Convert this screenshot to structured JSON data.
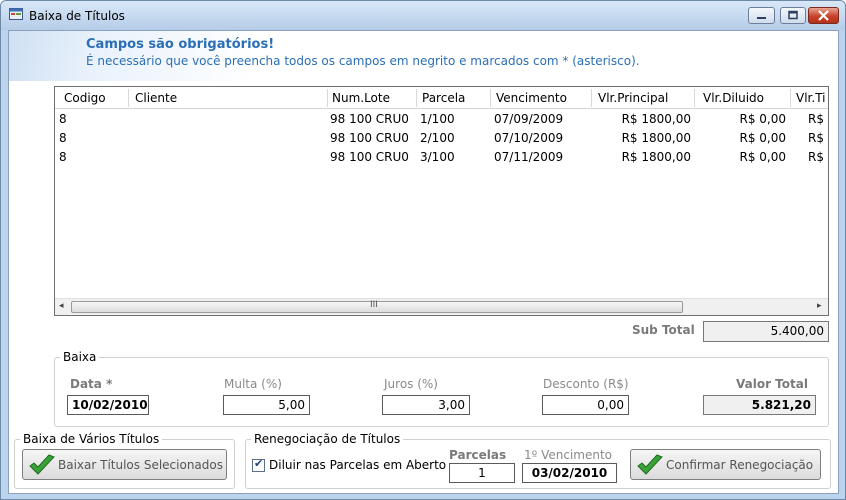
{
  "window": {
    "title": "Baixa de Títulos"
  },
  "header": {
    "title": "Campos são obrigatórios!",
    "subtitle": "É necessário que você preencha todos os campos em negrito e marcados com * (asterisco)."
  },
  "grid": {
    "columns": [
      "Codigo",
      "Cliente",
      "Num.Lote",
      "Parcela",
      "Vencimento",
      "Vlr.Principal",
      "Vlr.Diluido",
      "Vlr.Ti"
    ],
    "rows": [
      [
        "8",
        "",
        "98 100 CRU0",
        "1/100",
        "07/09/2009",
        "R$ 1800,00",
        "R$ 0,00",
        "R$"
      ],
      [
        "8",
        "",
        "98 100 CRU0",
        "2/100",
        "07/10/2009",
        "R$ 1800,00",
        "R$ 0,00",
        "R$"
      ],
      [
        "8",
        "",
        "98 100 CRU0",
        "3/100",
        "07/11/2009",
        "R$ 1800,00",
        "R$ 0,00",
        "R$"
      ]
    ],
    "scroll_left": "◂",
    "scroll_right": "▸",
    "scroll_grip": "III"
  },
  "subtotal": {
    "label": "Sub Total",
    "value": "5.400,00"
  },
  "baixa": {
    "group_title": "Baixa",
    "data_label": "Data *",
    "data_value": "10/02/2010",
    "multa_label": "Multa (%)",
    "multa_value": "5,00",
    "juros_label": "Juros (%)",
    "juros_value": "3,00",
    "desconto_label": "Desconto (R$)",
    "desconto_value": "0,00",
    "total_label": "Valor Total",
    "total_value": "5.821,20"
  },
  "varios": {
    "group_title": "Baixa de Vários Títulos",
    "button_label": "Baixar Títulos Selecionados"
  },
  "reneg": {
    "group_title": "Renegociação de Títulos",
    "checkbox_label": "Diluir nas Parcelas em Aberto",
    "checkbox_checked": true,
    "parcelas_label": "Parcelas",
    "parcelas_value": "1",
    "vencimento_label": "1º Vencimento",
    "vencimento_value": "03/02/2010",
    "button_label": "Confirmar Renegociação"
  },
  "icons": {
    "title": "form-window-icon",
    "check": "green-check-icon",
    "minimize": "minimize-icon",
    "maximize": "maximize-icon",
    "close": "close-icon"
  },
  "colors": {
    "accent_text": "#2b6fb6",
    "check_green": "#3aa23a",
    "close_red": "#c8412a"
  }
}
